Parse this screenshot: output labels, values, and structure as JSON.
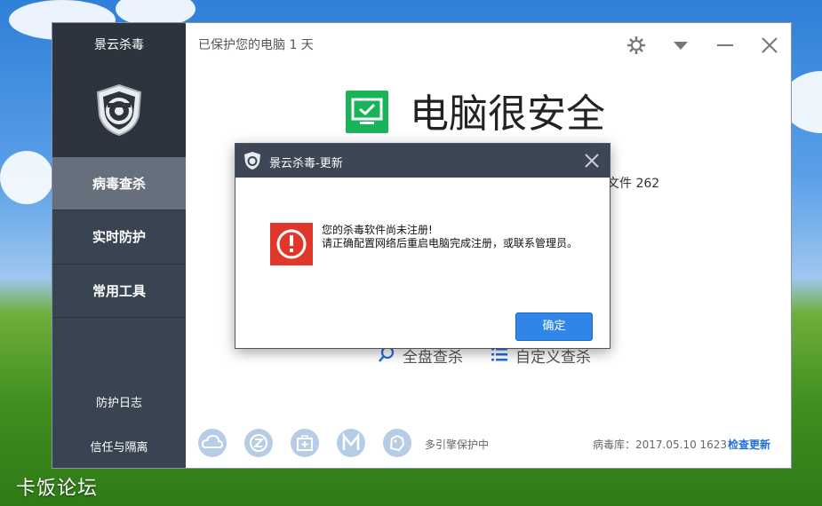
{
  "window": {
    "brand_title": "景云杀毒",
    "protect_days": "已保护您的电脑 1 天"
  },
  "sidebar": {
    "items": [
      {
        "label": "病毒查杀",
        "active": true
      },
      {
        "label": "实时防护",
        "active": false
      },
      {
        "label": "常用工具",
        "active": false
      }
    ],
    "links": [
      "防护日志",
      "信任与隔离"
    ]
  },
  "main": {
    "status_text": "电脑很安全",
    "partial_line": "文件 262",
    "full_scan_label": "全盘查杀",
    "custom_scan_label": "自定义查杀",
    "engines_label": "多引擎保护中",
    "virus_db": "病毒库：2017.05.10 1623",
    "check_update": "检查更新"
  },
  "dialog": {
    "title": "景云杀毒-更新",
    "message_line1": "您的杀毒软件尚未注册!",
    "message_line2": "请正确配置网络后重启电脑完成注册，或联系管理员。",
    "ok_label": "确定"
  },
  "watermark": "卡饭论坛",
  "colors": {
    "sidebar": "#384452",
    "sidebar_active": "#65707c",
    "safe_green": "#19b35a",
    "error_red": "#e0372b",
    "primary_blue": "#2f86e8"
  }
}
